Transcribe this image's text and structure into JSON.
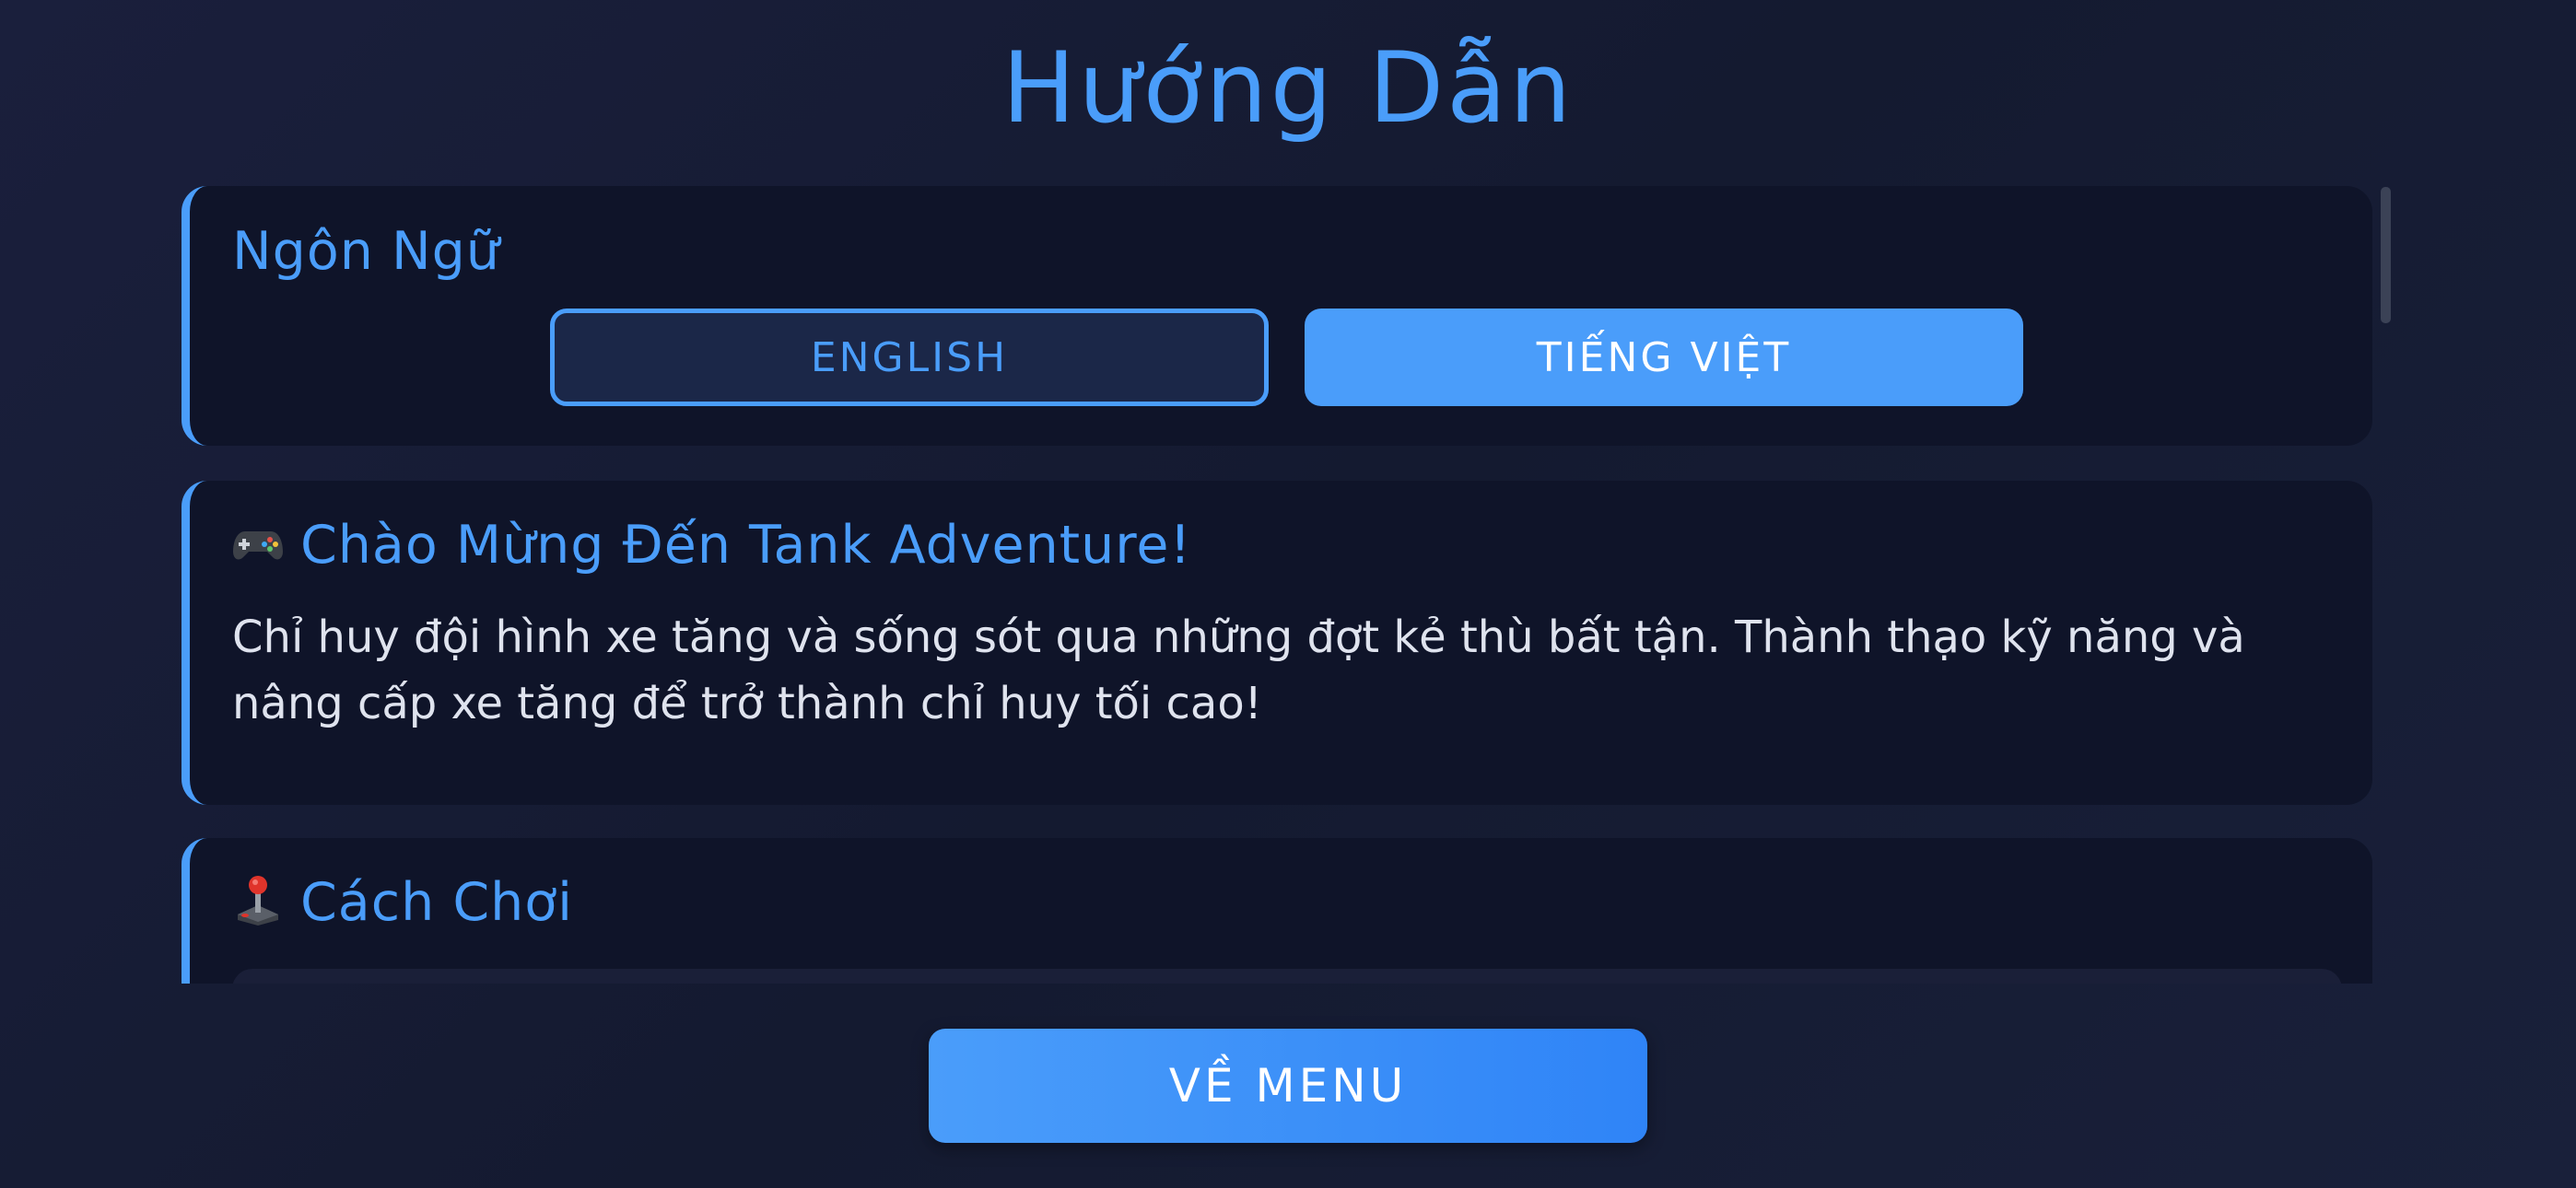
{
  "page": {
    "title": "Hướng Dẫn"
  },
  "language_card": {
    "title": "Ngôn Ngữ",
    "buttons": {
      "english": "ENGLISH",
      "vietnamese": "TIẾNG VIỆT"
    },
    "selected": "vietnamese"
  },
  "welcome_card": {
    "icon": "gamepad-icon",
    "title": "Chào Mừng Đến Tank Adventure!",
    "text": "Chỉ huy đội hình xe tăng và sống sót qua những đợt kẻ thù bất tận. Thành thạo kỹ năng và nâng cấp xe tăng để trở thành chỉ huy tối cao!"
  },
  "howto_card": {
    "icon": "joystick-icon",
    "title": "Cách Chơi"
  },
  "footer": {
    "menu_button": "VỀ MENU"
  },
  "colors": {
    "accent": "#4a9dfa",
    "background": "#161b33",
    "card": "#0f1429",
    "text": "#dfe3ee"
  }
}
